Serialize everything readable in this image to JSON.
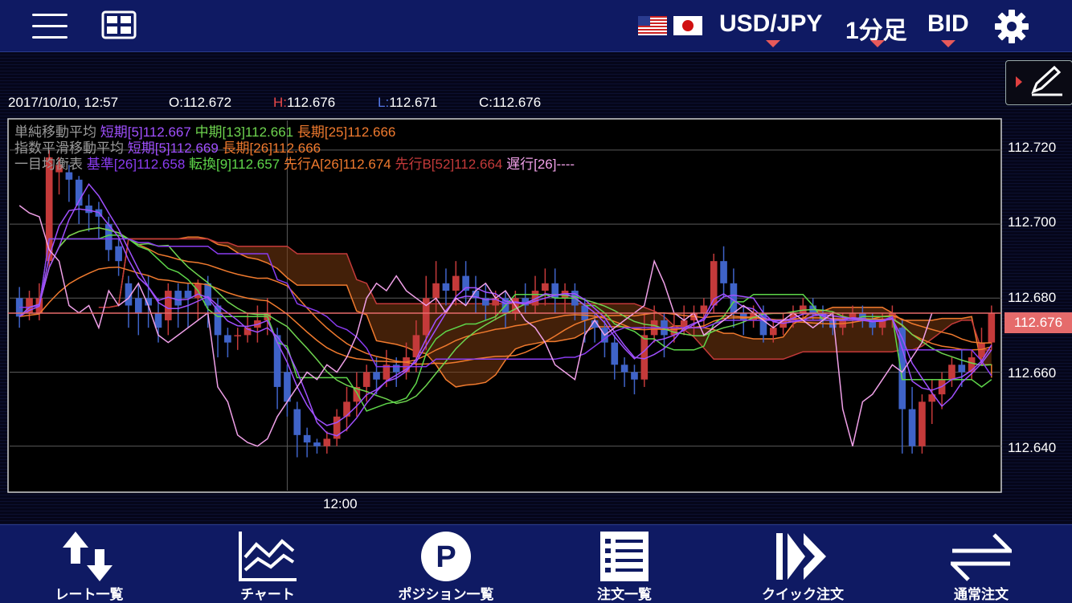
{
  "header": {
    "pair": "USD/JPY",
    "timeframe": "1分足",
    "price_type": "BID",
    "flags": [
      "us-flag",
      "japan-flag"
    ]
  },
  "ohlc": {
    "datetime": "2017/10/10, 12:57",
    "open": "O:112.672",
    "high_prefix": "H:",
    "high_value": "112.676",
    "low_prefix": "L:",
    "low_value": "112.671",
    "close": "C:112.676"
  },
  "legend": {
    "sma": {
      "name": "単純移動平均",
      "short": "短期[5]112.667",
      "mid": "中期[13]112.661",
      "long": "長期[25]112.666"
    },
    "ema": {
      "name": "指数平滑移動平均",
      "short": "短期[5]112.669",
      "long": "長期[26]112.666"
    },
    "ichimoku": {
      "name": "一目均衡表",
      "base": "基準[26]112.658",
      "conversion": "転換[9]112.657",
      "span_a": "先行A[26]112.674",
      "span_b": "先行B[52]112.664",
      "lagging": "遅行[26]----"
    }
  },
  "price_axis": [
    "112.720",
    "112.700",
    "112.680",
    "112.660",
    "112.640"
  ],
  "current_price": "112.676",
  "time_axis": [
    "12:00"
  ],
  "bottom_nav": [
    {
      "id": "rate-list",
      "label": "レート一覧",
      "icon": "rate-arrows-icon"
    },
    {
      "id": "chart",
      "label": "チャート",
      "icon": "chart-icon"
    },
    {
      "id": "position-list",
      "label": "ポジション一覧",
      "icon": "position-p-icon"
    },
    {
      "id": "order-list",
      "label": "注文一覧",
      "icon": "order-list-icon"
    },
    {
      "id": "quick-order",
      "label": "クイック注文",
      "icon": "quick-order-icon"
    },
    {
      "id": "normal-order",
      "label": "通常注文",
      "icon": "normal-order-icon"
    }
  ],
  "colors": {
    "nav_bg": "#0f1a63",
    "bull_candle": "#c43a3a",
    "bear_candle": "#3f63c8",
    "sma_short": "#a050ff",
    "sma_mid": "#6ed44f",
    "sma_long": "#f07a2e",
    "ema_short": "#a050ff",
    "ema_long": "#f07a2e",
    "ichimoku_base": "#8a3cf0",
    "ichimoku_conv": "#5ed64a",
    "ichimoku_span_a": "#f07a2e",
    "ichimoku_span_b": "#c43a3a",
    "ichimoku_lag": "#f0a0e8",
    "current_price_tag": "#e56b6b"
  },
  "chart_data": {
    "type": "candlestick",
    "ylim": [
      112.628,
      112.728
    ],
    "yticks": [
      112.64,
      112.66,
      112.68,
      112.7,
      112.72
    ],
    "x_labels": [
      {
        "index": 27,
        "label": "12:00"
      }
    ],
    "candles": [
      [
        112.68,
        112.675,
        112.683,
        112.672
      ],
      [
        112.676,
        112.68,
        112.682,
        112.674
      ],
      [
        112.676,
        112.68,
        112.684,
        112.674
      ],
      [
        112.69,
        112.718,
        112.72,
        112.688
      ],
      [
        112.714,
        112.716,
        112.718,
        112.708
      ],
      [
        112.714,
        112.712,
        112.716,
        112.706
      ],
      [
        112.712,
        112.705,
        112.713,
        112.7
      ],
      [
        112.705,
        112.703,
        112.708,
        112.698
      ],
      [
        112.704,
        112.702,
        112.706,
        112.696
      ],
      [
        112.7,
        112.693,
        112.702,
        112.69
      ],
      [
        112.694,
        112.69,
        112.696,
        112.686
      ],
      [
        112.684,
        112.678,
        112.686,
        112.672
      ],
      [
        112.68,
        112.676,
        112.684,
        112.67
      ],
      [
        112.68,
        112.678,
        112.686,
        112.672
      ],
      [
        112.676,
        112.672,
        112.68,
        112.668
      ],
      [
        112.674,
        112.682,
        112.684,
        112.67
      ],
      [
        112.682,
        112.678,
        112.684,
        112.672
      ],
      [
        112.682,
        112.68,
        112.684,
        112.672
      ],
      [
        112.68,
        112.684,
        112.685,
        112.674
      ],
      [
        112.684,
        112.678,
        112.686,
        112.672
      ],
      [
        112.678,
        112.67,
        112.68,
        112.664
      ],
      [
        112.67,
        112.668,
        112.672,
        112.664
      ],
      [
        112.67,
        112.67,
        112.672,
        112.666
      ],
      [
        112.67,
        112.672,
        112.676,
        112.668
      ],
      [
        112.672,
        112.674,
        112.678,
        112.668
      ],
      [
        112.674,
        112.676,
        112.68,
        112.67
      ],
      [
        112.67,
        112.656,
        112.672,
        112.65
      ],
      [
        112.66,
        112.652,
        112.662,
        112.648
      ],
      [
        112.65,
        112.643,
        112.652,
        112.637
      ],
      [
        112.643,
        112.641,
        112.645,
        112.637
      ],
      [
        112.641,
        112.64,
        112.642,
        112.638
      ],
      [
        112.64,
        112.642,
        112.644,
        112.638
      ],
      [
        112.642,
        112.648,
        112.65,
        112.64
      ],
      [
        112.648,
        112.652,
        112.656,
        112.644
      ],
      [
        112.652,
        112.656,
        112.66,
        112.648
      ],
      [
        112.656,
        112.66,
        112.662,
        112.652
      ],
      [
        112.66,
        112.658,
        112.664,
        112.654
      ],
      [
        112.658,
        112.662,
        112.666,
        112.656
      ],
      [
        112.662,
        112.66,
        112.664,
        112.656
      ],
      [
        112.66,
        112.664,
        112.668,
        112.658
      ],
      [
        112.664,
        112.67,
        112.674,
        112.66
      ],
      [
        112.67,
        112.68,
        112.686,
        112.666
      ],
      [
        112.68,
        112.684,
        112.69,
        112.676
      ],
      [
        112.684,
        112.682,
        112.688,
        112.678
      ],
      [
        112.682,
        112.686,
        112.69,
        112.678
      ],
      [
        112.686,
        112.682,
        112.69,
        112.678
      ],
      [
        112.682,
        112.68,
        112.686,
        112.676
      ],
      [
        112.68,
        112.678,
        112.684,
        112.674
      ],
      [
        112.678,
        112.68,
        112.682,
        112.674
      ],
      [
        112.68,
        112.676,
        112.682,
        112.672
      ],
      [
        112.676,
        112.68,
        112.682,
        112.674
      ],
      [
        112.68,
        112.678,
        112.684,
        112.676
      ],
      [
        112.678,
        112.682,
        112.686,
        112.676
      ],
      [
        112.682,
        112.684,
        112.688,
        112.678
      ],
      [
        112.684,
        112.68,
        112.688,
        112.676
      ],
      [
        112.68,
        112.682,
        112.684,
        112.676
      ],
      [
        112.682,
        112.678,
        112.684,
        112.674
      ],
      [
        112.678,
        112.674,
        112.68,
        112.668
      ],
      [
        112.674,
        112.672,
        112.676,
        112.668
      ],
      [
        112.672,
        112.668,
        112.674,
        112.664
      ],
      [
        112.668,
        112.662,
        112.67,
        112.658
      ],
      [
        112.662,
        112.66,
        112.664,
        112.656
      ],
      [
        112.66,
        112.658,
        112.662,
        112.654
      ],
      [
        112.658,
        112.67,
        112.676,
        112.656
      ],
      [
        112.67,
        112.674,
        112.678,
        112.668
      ],
      [
        112.674,
        112.67,
        112.676,
        112.664
      ],
      [
        112.67,
        112.672,
        112.676,
        112.668
      ],
      [
        112.672,
        112.674,
        112.678,
        112.67
      ],
      [
        112.674,
        112.676,
        112.678,
        112.67
      ],
      [
        112.676,
        112.678,
        112.68,
        112.672
      ],
      [
        112.678,
        112.69,
        112.692,
        112.676
      ],
      [
        112.69,
        112.684,
        112.694,
        112.68
      ],
      [
        112.684,
        112.676,
        112.688,
        112.672
      ],
      [
        112.676,
        112.674,
        112.678,
        112.67
      ],
      [
        112.674,
        112.676,
        112.678,
        112.672
      ],
      [
        112.676,
        112.67,
        112.678,
        112.668
      ],
      [
        112.67,
        112.672,
        112.674,
        112.668
      ],
      [
        112.672,
        112.674,
        112.676,
        112.67
      ],
      [
        112.674,
        112.676,
        112.678,
        112.672
      ],
      [
        112.676,
        112.678,
        112.68,
        112.674
      ],
      [
        112.678,
        112.676,
        112.68,
        112.674
      ],
      [
        112.676,
        112.674,
        112.678,
        112.672
      ],
      [
        112.674,
        112.672,
        112.676,
        112.67
      ],
      [
        112.672,
        112.674,
        112.676,
        112.67
      ],
      [
        112.674,
        112.676,
        112.678,
        112.672
      ],
      [
        112.676,
        112.674,
        112.678,
        112.672
      ],
      [
        112.674,
        112.672,
        112.676,
        112.67
      ],
      [
        112.672,
        112.674,
        112.676,
        112.67
      ],
      [
        112.674,
        112.676,
        112.678,
        112.672
      ],
      [
        112.672,
        112.65,
        112.674,
        112.638
      ],
      [
        112.65,
        112.64,
        112.656,
        112.638
      ],
      [
        112.64,
        112.652,
        112.654,
        112.638
      ],
      [
        112.652,
        112.654,
        112.658,
        112.646
      ],
      [
        112.654,
        112.658,
        112.66,
        112.65
      ],
      [
        112.658,
        112.662,
        112.664,
        112.656
      ],
      [
        112.662,
        112.66,
        112.666,
        112.656
      ],
      [
        112.66,
        112.664,
        112.666,
        112.658
      ],
      [
        112.664,
        112.668,
        112.672,
        112.662
      ],
      [
        112.668,
        112.676,
        112.678,
        112.666
      ]
    ]
  }
}
